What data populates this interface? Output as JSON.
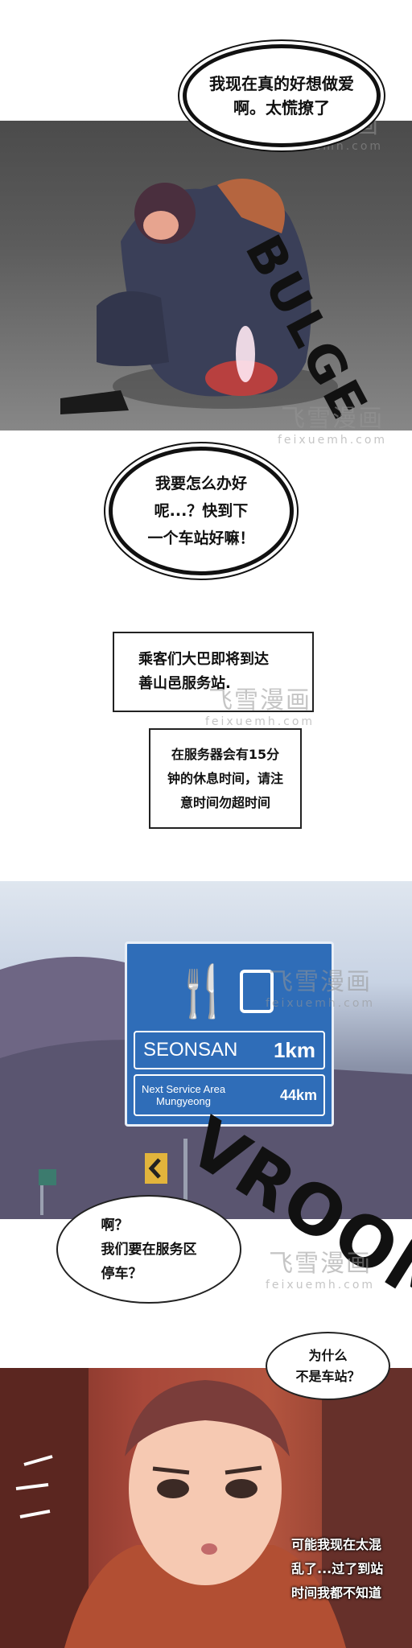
{
  "bubbles": {
    "b1": [
      "我现在真的好想做爱",
      "啊。太慌撩了"
    ],
    "b2": [
      "我要怎么办好",
      "呢...？快到下",
      "一个车站好嘛！"
    ],
    "b3": [
      "乘客们大巴即将到达",
      "善山邑服务站."
    ],
    "b4": [
      "在服务器会有15分",
      "钟的休息时间，请注",
      "意时间勿超时间"
    ],
    "b5": [
      "啊？",
      "我们要在服务区",
      "停车？"
    ],
    "b6": [
      "为什么",
      "不是车站？"
    ],
    "b7": [
      "可能我现在太混",
      "乱了...过了到站",
      "时间我都不知道"
    ]
  },
  "sfx": {
    "bulge": "BULGE",
    "vroom": "VROOM"
  },
  "sign": {
    "place": "SEONSAN",
    "place_dist": "1km",
    "next_line1": "Next Service Area",
    "next_line2": "Mungyeong",
    "next_dist": "44km"
  },
  "watermark": {
    "cn": "飞雪漫画",
    "en": "feixuemh.com"
  }
}
